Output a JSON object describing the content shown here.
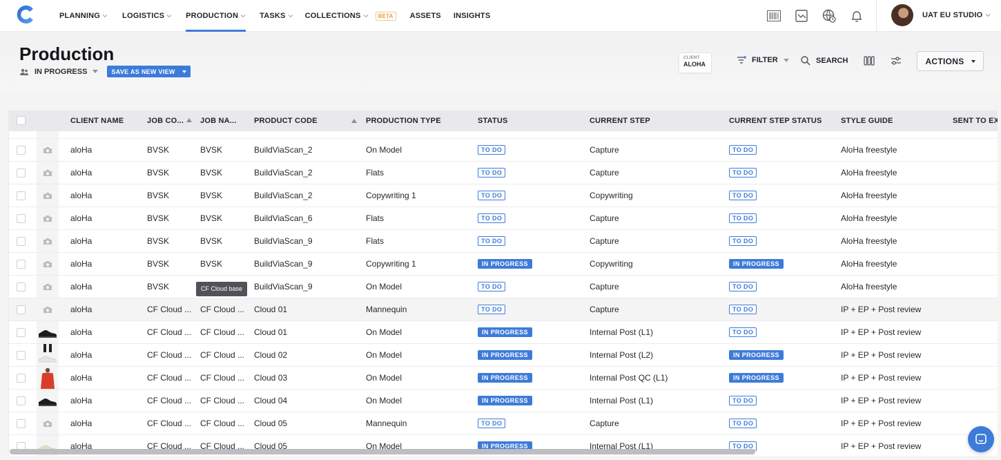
{
  "nav": {
    "items": [
      {
        "label": "PLANNING",
        "chevron": true,
        "active": false
      },
      {
        "label": "LOGISTICS",
        "chevron": true,
        "active": false
      },
      {
        "label": "PRODUCTION",
        "chevron": true,
        "active": true
      },
      {
        "label": "TASKS",
        "chevron": true,
        "active": false
      },
      {
        "label": "COLLECTIONS",
        "chevron": true,
        "active": false,
        "badge": "BETA"
      },
      {
        "label": "ASSETS",
        "chevron": false,
        "active": false
      },
      {
        "label": "INSIGHTS",
        "chevron": false,
        "active": false
      }
    ],
    "icons": [
      "barcode-icon",
      "chart-icon",
      "globe-clock-icon",
      "bell-icon"
    ],
    "studio": "UAT EU STUDIO",
    "accent_color": "#3d7bd9"
  },
  "header": {
    "title": "Production",
    "view_name": "IN PROGRESS",
    "save_view_label": "SAVE AS NEW VIEW",
    "client_key": "CLIENT",
    "client_value": "ALOHA",
    "filter_label": "FILTER",
    "search_label": "SEARCH",
    "actions_label": "ACTIONS"
  },
  "table": {
    "columns": [
      {
        "label": "CLIENT NAME"
      },
      {
        "label": "JOB CO...",
        "sort": "asc"
      },
      {
        "label": "JOB NA..."
      },
      {
        "label": "PRODUCT CODE",
        "sort": "asc"
      },
      {
        "label": "PRODUCTION TYPE"
      },
      {
        "label": "STATUS"
      },
      {
        "label": "CURRENT STEP"
      },
      {
        "label": "CURRENT STEP STATUS"
      },
      {
        "label": "STYLE GUIDE"
      },
      {
        "label": "SENT TO EX"
      }
    ],
    "rows": [
      {
        "thumb": "camera",
        "client": "aloHa",
        "job_code": "BVSK",
        "job_name": "BVSK",
        "product_code": "BuildViaScan_2",
        "production_type": "On Model",
        "status": "TO DO",
        "current_step": "Capture",
        "step_status": "TO DO",
        "style_guide": "AloHa freestyle"
      },
      {
        "thumb": "camera",
        "client": "aloHa",
        "job_code": "BVSK",
        "job_name": "BVSK",
        "product_code": "BuildViaScan_2",
        "production_type": "Flats",
        "status": "TO DO",
        "current_step": "Capture",
        "step_status": "TO DO",
        "style_guide": "AloHa freestyle"
      },
      {
        "thumb": "camera",
        "client": "aloHa",
        "job_code": "BVSK",
        "job_name": "BVSK",
        "product_code": "BuildViaScan_2",
        "production_type": "Copywriting 1",
        "status": "TO DO",
        "current_step": "Copywriting",
        "step_status": "TO DO",
        "style_guide": "AloHa freestyle"
      },
      {
        "thumb": "camera",
        "client": "aloHa",
        "job_code": "BVSK",
        "job_name": "BVSK",
        "product_code": "BuildViaScan_6",
        "production_type": "Flats",
        "status": "TO DO",
        "current_step": "Capture",
        "step_status": "TO DO",
        "style_guide": "AloHa freestyle"
      },
      {
        "thumb": "camera",
        "client": "aloHa",
        "job_code": "BVSK",
        "job_name": "BVSK",
        "product_code": "BuildViaScan_9",
        "production_type": "Flats",
        "status": "TO DO",
        "current_step": "Capture",
        "step_status": "TO DO",
        "style_guide": "AloHa freestyle"
      },
      {
        "thumb": "camera",
        "client": "aloHa",
        "job_code": "BVSK",
        "job_name": "BVSK",
        "product_code": "BuildViaScan_9",
        "production_type": "Copywriting 1",
        "status": "IN PROGRESS",
        "current_step": "Copywriting",
        "step_status": "IN PROGRESS",
        "style_guide": "AloHa freestyle"
      },
      {
        "thumb": "camera",
        "client": "aloHa",
        "job_code": "BVSK",
        "job_name": "",
        "product_code": "BuildViaScan_9",
        "production_type": "On Model",
        "status": "TO DO",
        "current_step": "Capture",
        "step_status": "TO DO",
        "style_guide": "AloHa freestyle"
      },
      {
        "thumb": "camera",
        "client": "aloHa",
        "job_code": "CF Cloud ...",
        "job_name": "CF Cloud ...",
        "product_code": "Cloud 01",
        "production_type": "Mannequin",
        "status": "TO DO",
        "current_step": "Capture",
        "step_status": "TO DO",
        "style_guide": "IP + EP + Post review",
        "highlight": true
      },
      {
        "thumb": "shoe-black",
        "client": "aloHa",
        "job_code": "CF Cloud ...",
        "job_name": "CF Cloud ...",
        "product_code": "Cloud 01",
        "production_type": "On Model",
        "status": "IN PROGRESS",
        "current_step": "Internal Post (L1)",
        "step_status": "TO DO",
        "style_guide": "IP + EP + Post review"
      },
      {
        "thumb": "shoe-white",
        "client": "aloHa",
        "job_code": "CF Cloud ...",
        "job_name": "CF Cloud ...",
        "product_code": "Cloud 02",
        "production_type": "On Model",
        "status": "IN PROGRESS",
        "current_step": "Internal Post (L2)",
        "step_status": "IN PROGRESS",
        "style_guide": "IP + EP + Post review"
      },
      {
        "thumb": "person-red",
        "client": "aloHa",
        "job_code": "CF Cloud ...",
        "job_name": "CF Cloud ...",
        "product_code": "Cloud 03",
        "production_type": "On Model",
        "status": "IN PROGRESS",
        "current_step": "Internal Post QC (L1)",
        "step_status": "IN PROGRESS",
        "style_guide": "IP + EP + Post review"
      },
      {
        "thumb": "shoe-black",
        "client": "aloHa",
        "job_code": "CF Cloud ...",
        "job_name": "CF Cloud ...",
        "product_code": "Cloud 04",
        "production_type": "On Model",
        "status": "IN PROGRESS",
        "current_step": "Internal Post (L1)",
        "step_status": "TO DO",
        "style_guide": "IP + EP + Post review"
      },
      {
        "thumb": "camera",
        "client": "aloHa",
        "job_code": "CF Cloud ...",
        "job_name": "CF Cloud ...",
        "product_code": "Cloud 05",
        "production_type": "Mannequin",
        "status": "TO DO",
        "current_step": "Capture",
        "step_status": "TO DO",
        "style_guide": "IP + EP + Post review"
      },
      {
        "thumb": "shoe-cream",
        "client": "aloHa",
        "job_code": "CF Cloud ...",
        "job_name": "CF Cloud ...",
        "product_code": "Cloud 05",
        "production_type": "On Model",
        "status": "IN PROGRESS",
        "current_step": "Internal Post (L1)",
        "step_status": "TO DO",
        "style_guide": "IP + EP + Post review"
      }
    ]
  },
  "tooltip": "CF Cloud base"
}
